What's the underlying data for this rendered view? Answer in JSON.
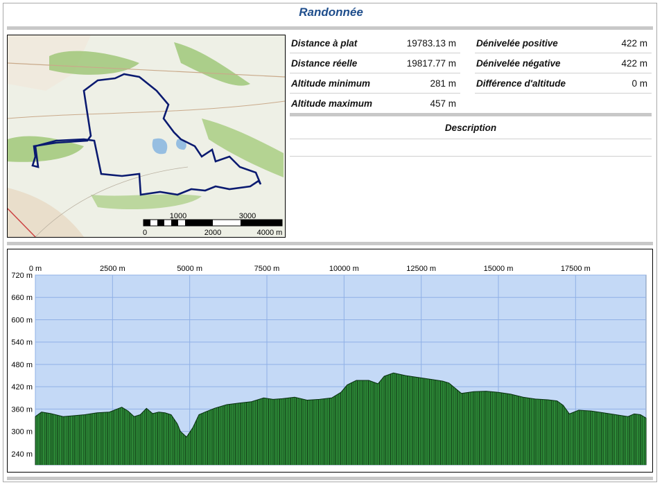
{
  "page": {
    "title": "Randonnée"
  },
  "map": {
    "scale_top": [
      "1000",
      "3000"
    ],
    "scale_bottom": [
      "0",
      "2000",
      "4000 m"
    ]
  },
  "stats": {
    "left": [
      {
        "label": "Distance à plat",
        "value": "19783.13 m"
      },
      {
        "label": "Distance réelle",
        "value": "19817.77 m"
      },
      {
        "label": "Altitude minimum",
        "value": "281 m"
      },
      {
        "label": "Altitude maximum",
        "value": "457 m"
      }
    ],
    "right": [
      {
        "label": "Dénivelée positive",
        "value": "422 m"
      },
      {
        "label": "Dénivelée négative",
        "value": "422 m"
      },
      {
        "label": "Différence d'altitude",
        "value": "0 m"
      }
    ]
  },
  "description": {
    "title": "Description"
  },
  "colors": {
    "title": "#1f4e8c",
    "sky": "#c4d9f6",
    "grid": "#8fb0e6",
    "terrain_fill": "#2f8f3a",
    "terrain_dark": "#0c2e10",
    "track": "#0a1a70"
  },
  "chart_data": {
    "type": "area",
    "x_ticks": [
      "0 m",
      "2500 m",
      "5000 m",
      "7500 m",
      "10000 m",
      "12500 m",
      "15000 m",
      "17500 m"
    ],
    "x_tick_values": [
      0,
      2500,
      5000,
      7500,
      10000,
      12500,
      15000,
      17500
    ],
    "y_ticks": [
      "720 m",
      "660 m",
      "600 m",
      "540 m",
      "480 m",
      "420 m",
      "360 m",
      "300 m",
      "240 m"
    ],
    "y_tick_values": [
      720,
      660,
      600,
      540,
      480,
      420,
      360,
      300,
      240
    ],
    "xlim": [
      0,
      19783
    ],
    "ylim": [
      210,
      720
    ],
    "x": [
      0,
      200,
      500,
      900,
      1200,
      1600,
      2000,
      2400,
      2800,
      3000,
      3200,
      3400,
      3600,
      3800,
      4000,
      4200,
      4400,
      4600,
      4700,
      4900,
      5100,
      5300,
      5500,
      5800,
      6200,
      6600,
      7000,
      7400,
      7700,
      8000,
      8400,
      8800,
      9200,
      9600,
      9900,
      10100,
      10400,
      10800,
      11100,
      11300,
      11600,
      12000,
      12400,
      12800,
      13200,
      13400,
      13800,
      14200,
      14600,
      15000,
      15400,
      15800,
      16200,
      16600,
      16900,
      17100,
      17300,
      17600,
      18000,
      18400,
      18800,
      19200,
      19400,
      19600,
      19783
    ],
    "y": [
      340,
      352,
      348,
      340,
      342,
      345,
      350,
      352,
      365,
      355,
      340,
      345,
      362,
      348,
      352,
      350,
      345,
      320,
      300,
      285,
      310,
      345,
      352,
      362,
      372,
      376,
      380,
      390,
      386,
      388,
      392,
      384,
      386,
      390,
      405,
      425,
      437,
      437,
      428,
      448,
      457,
      450,
      445,
      440,
      435,
      430,
      402,
      407,
      408,
      405,
      400,
      392,
      387,
      385,
      382,
      370,
      347,
      357,
      355,
      350,
      345,
      340,
      347,
      345,
      336
    ]
  }
}
